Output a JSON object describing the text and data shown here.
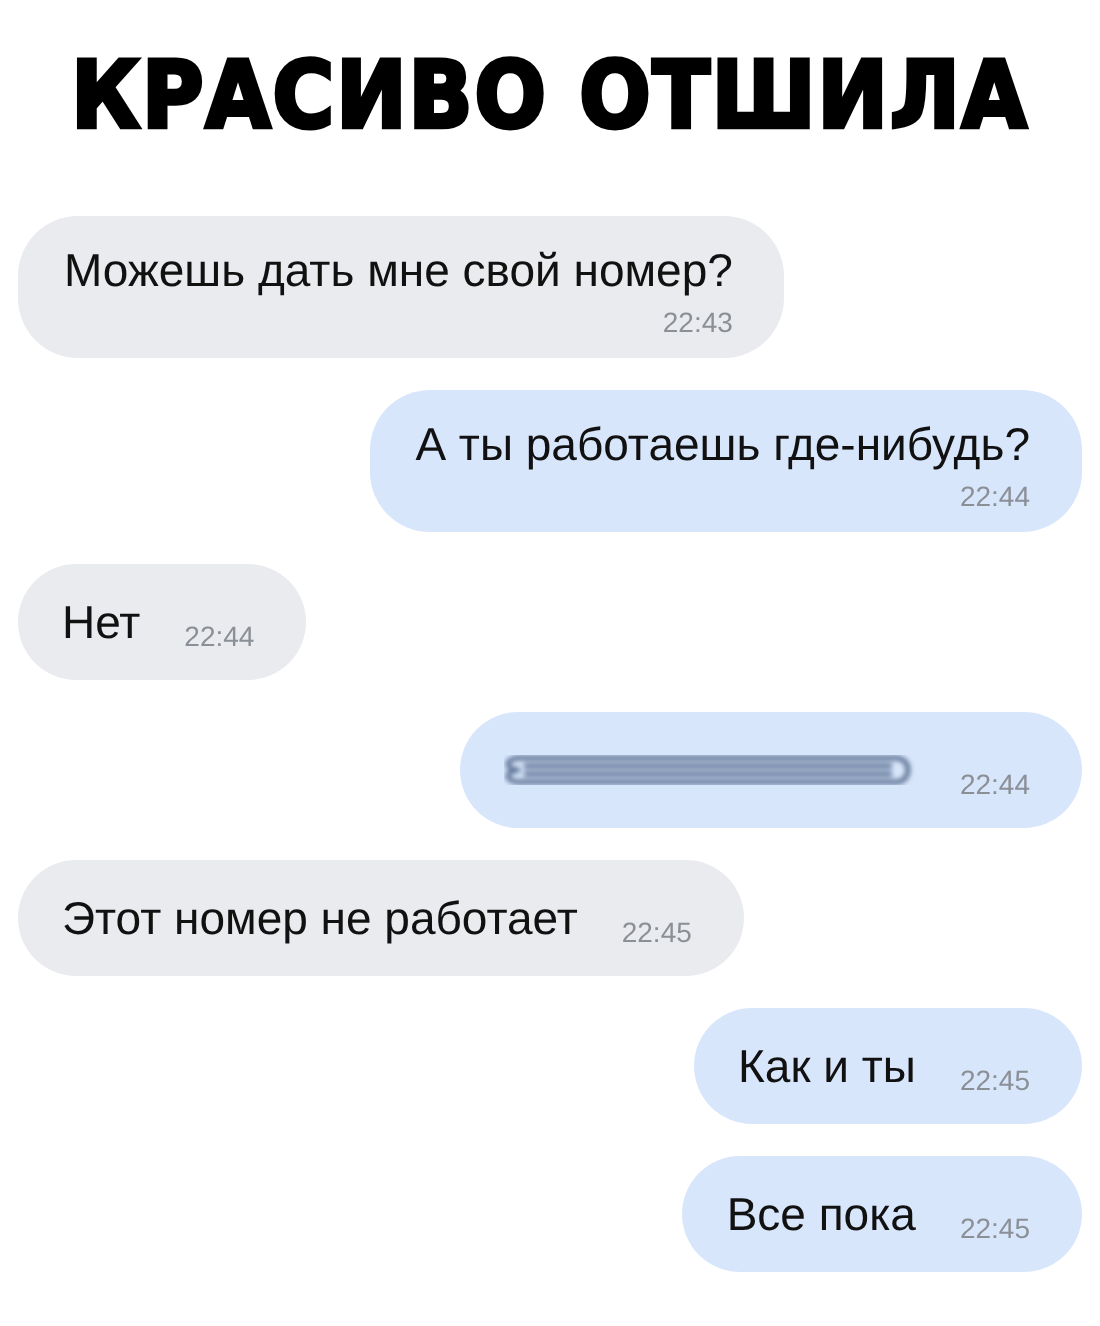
{
  "title": "КРАСИВО ОТШИЛА",
  "messages": [
    {
      "outgoing": false,
      "time_below": true,
      "kind": "text",
      "text": "Можешь дать мне свой номер?",
      "time": "22:43"
    },
    {
      "outgoing": true,
      "time_below": true,
      "kind": "text",
      "text": "А ты работаешь где-нибудь?",
      "time": "22:44"
    },
    {
      "outgoing": false,
      "time_below": false,
      "kind": "text",
      "text": "Нет",
      "time": "22:44"
    },
    {
      "outgoing": true,
      "time_below": false,
      "kind": "redacted",
      "time": "22:44"
    },
    {
      "outgoing": false,
      "time_below": false,
      "kind": "text",
      "text": "Этот номер не работает",
      "time": "22:45"
    },
    {
      "outgoing": true,
      "time_below": false,
      "kind": "text",
      "text": "Как и ты",
      "time": "22:45"
    },
    {
      "outgoing": true,
      "time_below": false,
      "kind": "text",
      "text": "Все пока",
      "time": "22:45"
    }
  ]
}
